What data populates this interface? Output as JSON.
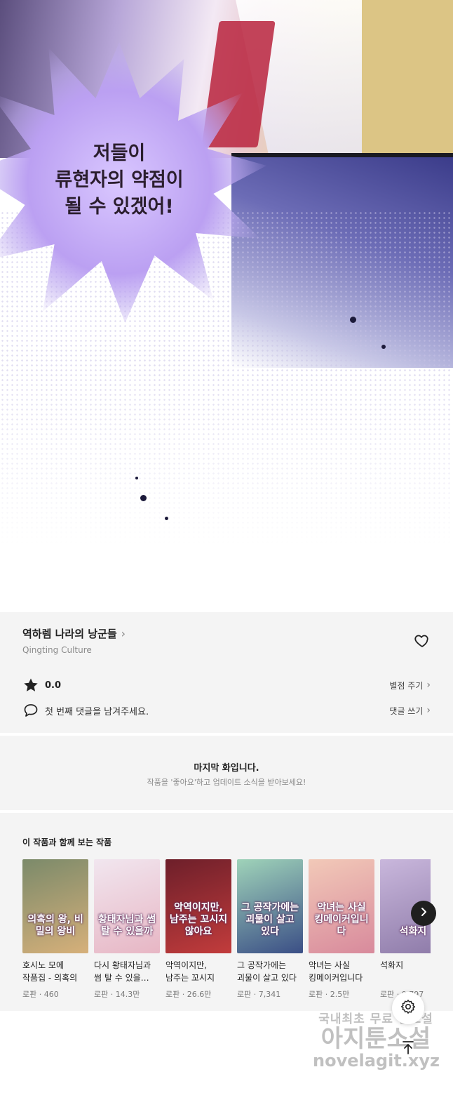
{
  "comic": {
    "speech_lines": [
      "저들이",
      "류현자의 약점이",
      "될 수 있겠어!"
    ]
  },
  "series": {
    "title": "역하렘 나라의 낭군들",
    "chevron": "›",
    "author": "Qingting Culture",
    "rating_value": "0.0",
    "rate_action": "별점 주기",
    "comment_prompt": "첫 번째 댓글을 남겨주세요.",
    "comment_action": "댓글 쓰기"
  },
  "end_notice": {
    "title": "마지막 화입니다.",
    "subtitle": "작품을 '좋아요'하고 업데이트 소식을 받아보세요!"
  },
  "recommendations": {
    "heading": "이 작품과 함께 보는 작품",
    "items": [
      {
        "cover_text": "의혹의 왕, 비밀의 왕비",
        "title": "호시노 모에 작품집 - 의혹의 왕,…",
        "genre": "로판",
        "views": "460",
        "meta": "로판 · 460",
        "color_a": "#7b8a6a",
        "color_b": "#d6b07a"
      },
      {
        "cover_text": "황태자님과 썸 탈 수 있을까",
        "title": "다시 황태자님과 썸 탈 수 있을…",
        "genre": "로판",
        "views": "14.3만",
        "meta": "로판 · 14.3만",
        "color_a": "#f1e6ef",
        "color_b": "#e7b6c4"
      },
      {
        "cover_text": "악역이지만, 남주는 꼬시지 않아요",
        "title": "악역이지만, 남주는 꼬시지 않아요",
        "genre": "로판",
        "views": "26.6만",
        "meta": "로판 · 26.6만",
        "color_a": "#6d1f2a",
        "color_b": "#c23c3c"
      },
      {
        "cover_text": "그 공작가에는 괴물이 살고 있다",
        "title": "그 공작가에는 괴물이 살고 있다",
        "genre": "로판",
        "views": "7,341",
        "meta": "로판 · 7,341",
        "color_a": "#9fd3b9",
        "color_b": "#3b4f86"
      },
      {
        "cover_text": "악녀는 사실 킹메이커입니다",
        "title": "악녀는 사실 킹메이커입니다",
        "genre": "로판",
        "views": "2.5만",
        "meta": "로판 · 2.5만",
        "color_a": "#f2c9b8",
        "color_b": "#d88a9c"
      },
      {
        "cover_text": "석화지",
        "title": "석화지",
        "genre": "로판",
        "views": "9,797",
        "meta": "로판 · 9,797",
        "color_a": "#c9b7dc",
        "color_b": "#8d7aa8"
      }
    ]
  },
  "watermark": {
    "line1": "국내최초 무료 웹소설",
    "line2": "아지툰소설",
    "line3": "novelagit.xyz"
  },
  "icons": {
    "heart": "heart-outline-icon",
    "star": "star-filled-icon",
    "comment": "speech-bubble-icon",
    "next": "chevron-right-icon",
    "settings": "gear-icon",
    "top": "arrow-up-icon"
  }
}
